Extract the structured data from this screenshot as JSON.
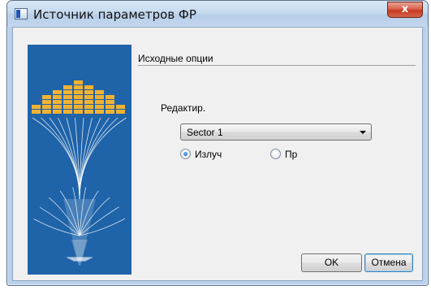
{
  "window": {
    "title": "Источник параметров ФР",
    "close_glyph": "x"
  },
  "dialog": {
    "section_header": "Исходные опции",
    "edit_label": "Редактир.",
    "combo": {
      "selected": "Sector 1"
    },
    "radios": [
      {
        "label": "Излуч",
        "checked": true
      },
      {
        "label": "Пр",
        "checked": false
      }
    ],
    "buttons": {
      "ok": "OK",
      "cancel": "Отмена"
    }
  },
  "icons": {
    "app": "app-window-icon",
    "close": "close-icon",
    "dropdown": "chevron-down-icon",
    "banner": "antenna-beam-illustration"
  },
  "colors": {
    "banner_bg": "#1f63a9",
    "banner_bars": "#f2b233",
    "close_button": "#c7381f"
  }
}
